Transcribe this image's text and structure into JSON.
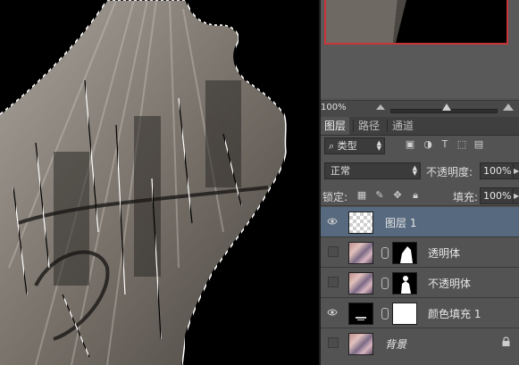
{
  "navigator": {
    "zoom": "100%"
  },
  "panel_tabs": [
    {
      "label": "图层",
      "active": true
    },
    {
      "label": "路径",
      "active": false
    },
    {
      "label": "通道",
      "active": false
    }
  ],
  "filter": {
    "kind_label": "类型",
    "icons": [
      "image-filter-icon",
      "adjustment-filter-icon",
      "type-filter-icon",
      "shape-filter-icon",
      "smart-object-filter-icon"
    ]
  },
  "blend": {
    "mode": "正常",
    "opacity_label": "不透明度:",
    "opacity_value": "100%"
  },
  "lock": {
    "label": "锁定:",
    "fill_label": "填充:",
    "fill_value": "100%"
  },
  "layers": [
    {
      "name": "图层 1",
      "visible": true,
      "selected": true,
      "thumb": "transparent"
    },
    {
      "name": "透明体",
      "visible": false,
      "selected": false,
      "thumb": "photo",
      "mask": "black-with-white-shape"
    },
    {
      "name": "不透明体",
      "visible": false,
      "selected": false,
      "thumb": "photo",
      "mask": "black-with-white-figure"
    },
    {
      "name": "颜色填充 1",
      "visible": true,
      "selected": false,
      "thumb": "black-fill",
      "mask": "white"
    },
    {
      "name": "背景",
      "visible": false,
      "selected": false,
      "thumb": "photo",
      "locked": true
    }
  ],
  "colors": {
    "panel_bg": "#535353",
    "selected_layer": "#56697e",
    "navigator_frame": "#c8363a",
    "canvas_bg": "#000000"
  }
}
